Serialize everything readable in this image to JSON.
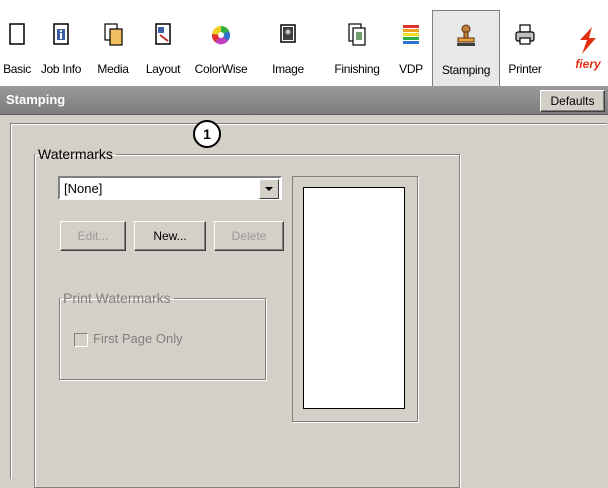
{
  "toolbar": {
    "tabs": [
      {
        "label": "Basic",
        "icon": "blank-page-icon"
      },
      {
        "label": "Job Info",
        "icon": "info-page-icon"
      },
      {
        "label": "Media",
        "icon": "media-page-icon"
      },
      {
        "label": "Layout",
        "icon": "layout-page-icon"
      },
      {
        "label": "ColorWise",
        "icon": "color-wheel-icon"
      },
      {
        "label": "Image",
        "icon": "image-icon"
      },
      {
        "label": "Finishing",
        "icon": "finishing-icon"
      },
      {
        "label": "VDP",
        "icon": "vdp-stack-icon"
      },
      {
        "label": "Stamping",
        "icon": "stamp-icon"
      },
      {
        "label": "Printer",
        "icon": "printer-icon"
      }
    ],
    "selected": "Stamping",
    "logo_text": "fiery"
  },
  "header": {
    "title": "Stamping",
    "defaults_label": "Defaults"
  },
  "callout": "1",
  "watermarks": {
    "legend": "Watermarks",
    "selected_value": "[None]",
    "edit_label": "Edit...",
    "new_label": "New...",
    "delete_label": "Delete"
  },
  "print_watermarks": {
    "legend": "Print Watermarks",
    "first_page_only_label": "First Page Only",
    "first_page_only_checked": false
  },
  "colors": {
    "header_bar": "#8a8a8a",
    "panel": "#d4d0c8",
    "accent": "#e03010"
  }
}
